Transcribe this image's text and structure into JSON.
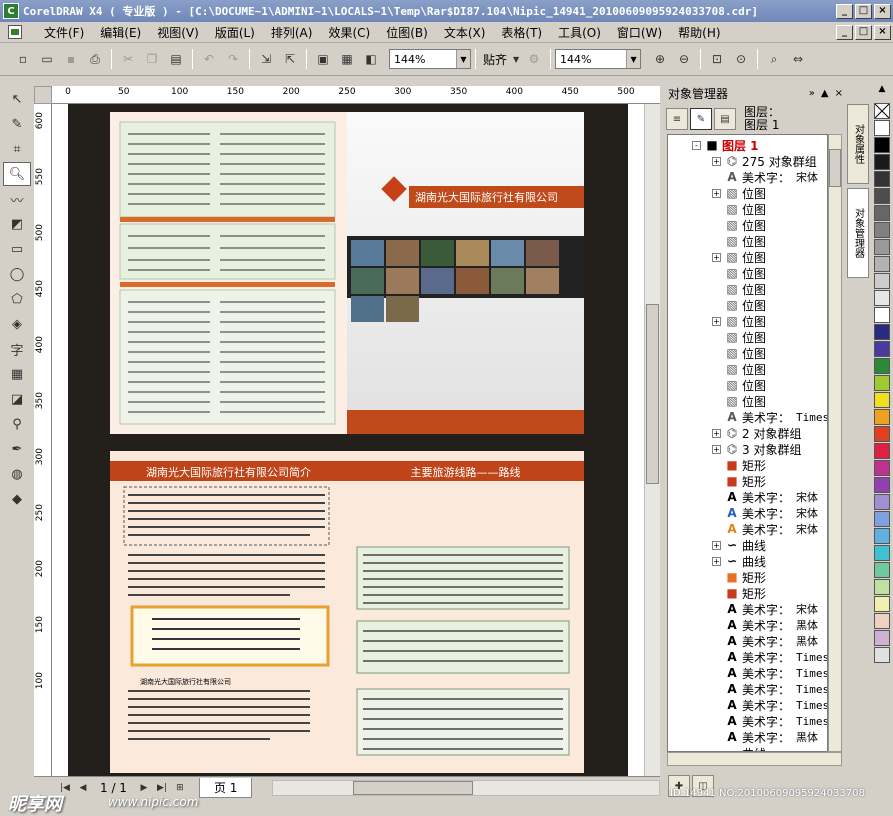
{
  "window": {
    "title": "CorelDRAW X4 ( 专业版 ) - [C:\\DOCUME~1\\ADMINI~1\\LOCALS~1\\Temp\\Rar$DI87.104\\Nipic_14941_20100609095924033708.cdr]",
    "minimize": "_",
    "maximize": "□",
    "close": "×"
  },
  "menu": [
    "文件(F)",
    "编辑(E)",
    "视图(V)",
    "版面(L)",
    "排列(A)",
    "效果(C)",
    "位图(B)",
    "文本(X)",
    "表格(T)",
    "工具(O)",
    "窗口(W)",
    "帮助(H)"
  ],
  "toolbar": {
    "zoom_value": "144%",
    "snap_label": "贴齐",
    "zoom_value_2": "144%"
  },
  "rulers": {
    "h_ticks": [
      "0",
      "50",
      "100",
      "150",
      "200",
      "250",
      "300",
      "350",
      "400",
      "450",
      "500"
    ],
    "v_ticks": [
      "600",
      "550",
      "500",
      "450",
      "400",
      "350",
      "300",
      "250",
      "200",
      "150",
      "100"
    ]
  },
  "canvas": {
    "cover_title": "湖南光大国际旅行社有限公司",
    "intro_title": "湖南光大国际旅行社有限公司简介",
    "service_title": "主要旅游线路——路线",
    "company_label": "湖南光大国际旅行社有限公司"
  },
  "bottombar": {
    "page_counter": "1 / 1",
    "page_tab": "页 1"
  },
  "docker": {
    "title": "对象管理器",
    "layer_label": "图层：",
    "layer_name": "图层 1",
    "tree": [
      {
        "level": 0,
        "exp": "-",
        "icon": "layer",
        "label": "图层 1",
        "font": "",
        "color": "#cc0000"
      },
      {
        "level": 1,
        "exp": "+",
        "icon": "group",
        "label": "275 对象群组",
        "font": ""
      },
      {
        "level": 1,
        "exp": "",
        "icon": "text-outline",
        "label": "美术字：",
        "font": "宋体"
      },
      {
        "level": 1,
        "exp": "+",
        "icon": "bitmap",
        "label": "位图",
        "font": ""
      },
      {
        "level": 1,
        "exp": "",
        "icon": "bitmap",
        "label": "位图",
        "font": ""
      },
      {
        "level": 1,
        "exp": "",
        "icon": "bitmap",
        "label": "位图",
        "font": ""
      },
      {
        "level": 1,
        "exp": "",
        "icon": "bitmap",
        "label": "位图",
        "font": ""
      },
      {
        "level": 1,
        "exp": "+",
        "icon": "bitmap",
        "label": "位图",
        "font": ""
      },
      {
        "level": 1,
        "exp": "",
        "icon": "bitmap",
        "label": "位图",
        "font": ""
      },
      {
        "level": 1,
        "exp": "",
        "icon": "bitmap",
        "label": "位图",
        "font": ""
      },
      {
        "level": 1,
        "exp": "",
        "icon": "bitmap",
        "label": "位图",
        "font": ""
      },
      {
        "level": 1,
        "exp": "+",
        "icon": "bitmap",
        "label": "位图",
        "font": ""
      },
      {
        "level": 1,
        "exp": "",
        "icon": "bitmap",
        "label": "位图",
        "font": ""
      },
      {
        "level": 1,
        "exp": "",
        "icon": "bitmap",
        "label": "位图",
        "font": ""
      },
      {
        "level": 1,
        "exp": "",
        "icon": "bitmap",
        "label": "位图",
        "font": ""
      },
      {
        "level": 1,
        "exp": "",
        "icon": "bitmap",
        "label": "位图",
        "font": ""
      },
      {
        "level": 1,
        "exp": "",
        "icon": "bitmap",
        "label": "位图",
        "font": ""
      },
      {
        "level": 1,
        "exp": "",
        "icon": "text-outline",
        "label": "美术字：",
        "font": "Times"
      },
      {
        "level": 1,
        "exp": "+",
        "icon": "group",
        "label": "2 对象群组",
        "font": ""
      },
      {
        "level": 1,
        "exp": "+",
        "icon": "group",
        "label": "3 对象群组",
        "font": ""
      },
      {
        "level": 1,
        "exp": "",
        "icon": "rect",
        "label": "矩形",
        "font": ""
      },
      {
        "level": 1,
        "exp": "",
        "icon": "rect",
        "label": "矩形",
        "font": ""
      },
      {
        "level": 1,
        "exp": "",
        "icon": "text-solid",
        "label": "美术字：",
        "font": "宋体"
      },
      {
        "level": 1,
        "exp": "",
        "icon": "text-blue",
        "label": "美术字：",
        "font": "宋体"
      },
      {
        "level": 1,
        "exp": "",
        "icon": "text-orange",
        "label": "美术字：",
        "font": "宋体"
      },
      {
        "level": 1,
        "exp": "+",
        "icon": "curve",
        "label": "曲线",
        "font": ""
      },
      {
        "level": 1,
        "exp": "+",
        "icon": "curve",
        "label": "曲线",
        "font": ""
      },
      {
        "level": 1,
        "exp": "",
        "icon": "rect-orange",
        "label": "矩形",
        "font": ""
      },
      {
        "level": 1,
        "exp": "",
        "icon": "rect",
        "label": "矩形",
        "font": ""
      },
      {
        "level": 1,
        "exp": "",
        "icon": "text-solid",
        "label": "美术字：",
        "font": "宋体"
      },
      {
        "level": 1,
        "exp": "",
        "icon": "text-solid",
        "label": "美术字：",
        "font": "黑体"
      },
      {
        "level": 1,
        "exp": "",
        "icon": "text-solid",
        "label": "美术字：",
        "font": "黑体"
      },
      {
        "level": 1,
        "exp": "",
        "icon": "text-solid",
        "label": "美术字：",
        "font": "Times"
      },
      {
        "level": 1,
        "exp": "",
        "icon": "text-solid",
        "label": "美术字：",
        "font": "Times"
      },
      {
        "level": 1,
        "exp": "",
        "icon": "text-solid",
        "label": "美术字：",
        "font": "Times"
      },
      {
        "level": 1,
        "exp": "",
        "icon": "text-solid",
        "label": "美术字：",
        "font": "Times"
      },
      {
        "level": 1,
        "exp": "",
        "icon": "text-solid",
        "label": "美术字：",
        "font": "Times"
      },
      {
        "level": 1,
        "exp": "",
        "icon": "text-solid",
        "label": "美术字：",
        "font": "黑体"
      },
      {
        "level": 1,
        "exp": "",
        "icon": "curve",
        "label": "曲线",
        "font": ""
      }
    ]
  },
  "side_tabs": [
    "对象属性",
    "对象管理器"
  ],
  "palette": [
    "#ffffff",
    "#000000",
    "#1a1a1a",
    "#333333",
    "#4d4d4d",
    "#666666",
    "#808080",
    "#999999",
    "#b3b3b3",
    "#cccccc",
    "#e6e6e6",
    "#ffffff",
    "#2a2a80",
    "#4a3aa0",
    "#2a8a3a",
    "#a0c830",
    "#f0e020",
    "#f0a020",
    "#e04020",
    "#e02040",
    "#c03090",
    "#9040b0",
    "#a090d0",
    "#80a0e0",
    "#60b0e0",
    "#40c0d0",
    "#70c8a0",
    "#c0e0a0",
    "#f0f0b0",
    "#f0d0c0",
    "#d0b0d0",
    "#e0e0e0"
  ],
  "watermark": {
    "id_text": "ID:14941 NO:20100609095924033708",
    "site_cn": "昵享网",
    "site_url": "www.nipic.com"
  }
}
